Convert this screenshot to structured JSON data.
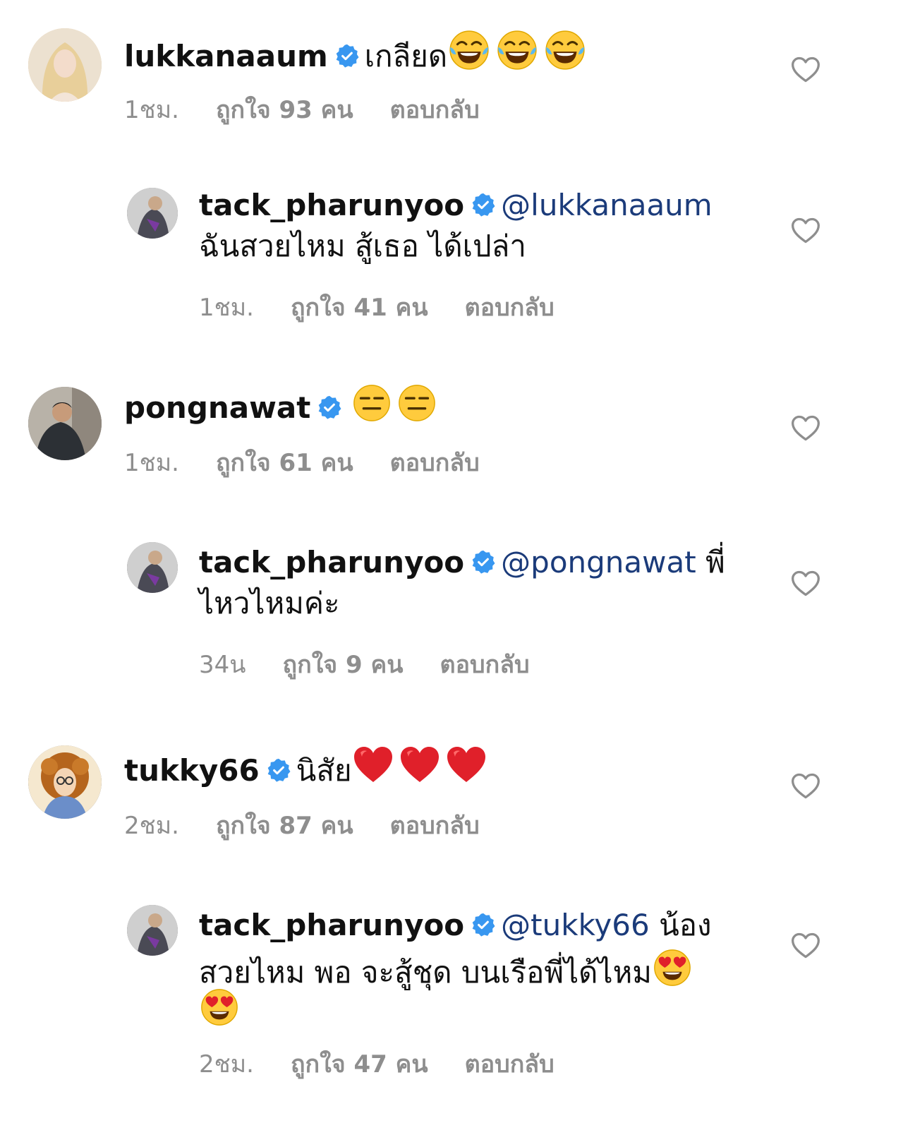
{
  "comments": [
    {
      "username": "lukkanaaum",
      "text": "เกลียด",
      "emojis": [
        "😂",
        "😂",
        "😂"
      ],
      "time": "1ชม.",
      "likes": "ถูกใจ 93 คน",
      "reply": "ตอบกลับ"
    },
    {
      "username": "tack_pharunyoo",
      "mention": "@lukkanaaum",
      "text_line1": "",
      "text_line2": "ฉันสวยไหม สู้เธอ ได้เปล่า",
      "time": "1ชม.",
      "likes": "ถูกใจ 41 คน",
      "reply": "ตอบกลับ"
    },
    {
      "username": "pongnawat",
      "text": "",
      "emojis": [
        "😑",
        "😑"
      ],
      "time": "1ชม.",
      "likes": "ถูกใจ 61 คน",
      "reply": "ตอบกลับ"
    },
    {
      "username": "tack_pharunyoo",
      "mention": "@pongnawat",
      "text_line1": "พี่",
      "text_line2": "ไหวไหมค่ะ",
      "time": "34น",
      "likes": "ถูกใจ 9 คน",
      "reply": "ตอบกลับ"
    },
    {
      "username": "tukky66",
      "text": "นิสัย",
      "emojis": [
        "❤️",
        "❤️",
        "❤️"
      ],
      "time": "2ชม.",
      "likes": "ถูกใจ 87 คน",
      "reply": "ตอบกลับ"
    },
    {
      "username": "tack_pharunyoo",
      "mention": "@tukky66",
      "text_line1": "น้อง",
      "text_line2": "สวยไหม พอ จะสู้ชุด บนเรือพี่ได้ไหม",
      "emojis_line2": [
        "😍"
      ],
      "emojis_line3": [
        "😍"
      ],
      "time": "2ชม.",
      "likes": "ถูกใจ 47 คน",
      "reply": "ตอบกลับ"
    }
  ],
  "icons": {
    "verified": "verified-badge-icon",
    "like": "heart-outline-icon"
  },
  "colors": {
    "verified": "#3897f0",
    "meta": "#8e8e8e",
    "mention": "#1b3b7a"
  }
}
